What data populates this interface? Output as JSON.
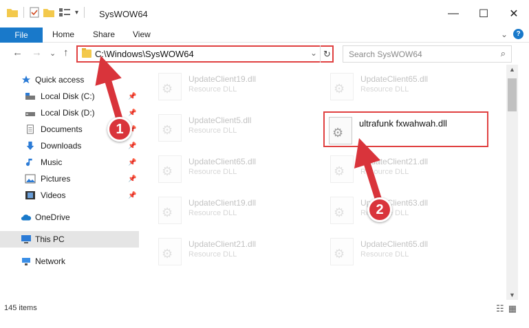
{
  "window": {
    "title": "SysWOW64",
    "minimize": "—",
    "maximize": "☐",
    "close": "✕"
  },
  "ribbon": {
    "file": "File",
    "home": "Home",
    "share": "Share",
    "view": "View",
    "expand": "⌄",
    "help": "?"
  },
  "address": {
    "path": "C:\\Windows\\SysWOW64",
    "dropdown": "⌄",
    "refresh": "↻"
  },
  "search": {
    "placeholder": "Search SysWOW64",
    "icon": "⌕"
  },
  "nav": {
    "back": "←",
    "forward": "→",
    "recent": "⌄",
    "up": "↑"
  },
  "sidebar": {
    "items": [
      {
        "label": "Quick access",
        "icon": "star-icon",
        "pinned": false
      },
      {
        "label": "Local Disk (C:)",
        "icon": "drive-icon",
        "pinned": true
      },
      {
        "label": "Local Disk (D:)",
        "icon": "drive-icon",
        "pinned": true
      },
      {
        "label": "Documents",
        "icon": "documents-icon",
        "pinned": true
      },
      {
        "label": "Downloads",
        "icon": "downloads-icon",
        "pinned": true
      },
      {
        "label": "Music",
        "icon": "music-icon",
        "pinned": true
      },
      {
        "label": "Pictures",
        "icon": "pictures-icon",
        "pinned": true
      },
      {
        "label": "Videos",
        "icon": "videos-icon",
        "pinned": true
      },
      {
        "label": "OneDrive",
        "icon": "onedrive-icon",
        "pinned": false
      },
      {
        "label": "This PC",
        "icon": "computer-icon",
        "pinned": false,
        "selected": true
      },
      {
        "label": "Network",
        "icon": "network-icon",
        "pinned": false
      }
    ],
    "pin_glyph": "📌"
  },
  "files": [
    {
      "name": "UpdateClient19.dll",
      "type": "Resource DLL"
    },
    {
      "name": "UpdateClient65.dll",
      "type": "Resource DLL"
    },
    {
      "name": "UpdateClient5.dll",
      "type": "Resource DLL"
    },
    {
      "name": "ultrafunk fxwahwah.dll",
      "type": ""
    },
    {
      "name": "UpdateClient65.dll",
      "type": "Resource DLL"
    },
    {
      "name": "UpdateClient21.dll",
      "type": "Resource DLL"
    },
    {
      "name": "UpdateClient19.dll",
      "type": "Resource DLL"
    },
    {
      "name": "UpdateClient63.dll",
      "type": "Resource DLL"
    },
    {
      "name": "UpdateClient21.dll",
      "type": "Resource DLL"
    },
    {
      "name": "UpdateClient65.dll",
      "type": "Resource DLL"
    }
  ],
  "status": {
    "count": "145 items"
  },
  "annotations": {
    "step1": "1",
    "step2": "2",
    "color": "#d9343b"
  }
}
